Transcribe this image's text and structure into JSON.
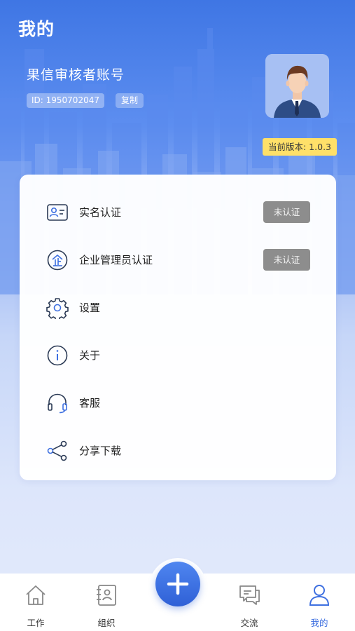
{
  "header": {
    "title": "我的",
    "account_name": "果信审核者账号",
    "account_id": "ID: 1950702047",
    "copy_label": "复制",
    "version": "当前版本: 1.0.3"
  },
  "menu": {
    "items": [
      {
        "label": "实名认证",
        "icon": "id-card-icon",
        "status": "未认证"
      },
      {
        "label": "企业管理员认证",
        "icon": "enterprise-icon",
        "status": "未认证"
      },
      {
        "label": "设置",
        "icon": "gear-icon"
      },
      {
        "label": "关于",
        "icon": "info-icon"
      },
      {
        "label": "客服",
        "icon": "headset-icon"
      },
      {
        "label": "分享下载",
        "icon": "share-icon"
      }
    ]
  },
  "tabbar": {
    "tabs": [
      {
        "label": "工作",
        "icon": "home-icon"
      },
      {
        "label": "组织",
        "icon": "contacts-icon"
      },
      {
        "label": "交流",
        "icon": "chat-icon"
      },
      {
        "label": "我的",
        "icon": "user-icon",
        "active": true
      }
    ],
    "fab_icon": "plus-icon"
  },
  "colors": {
    "primary": "#3d6fe0",
    "badge_yellow": "#ffe069",
    "status_gray": "#8d8d8d"
  }
}
